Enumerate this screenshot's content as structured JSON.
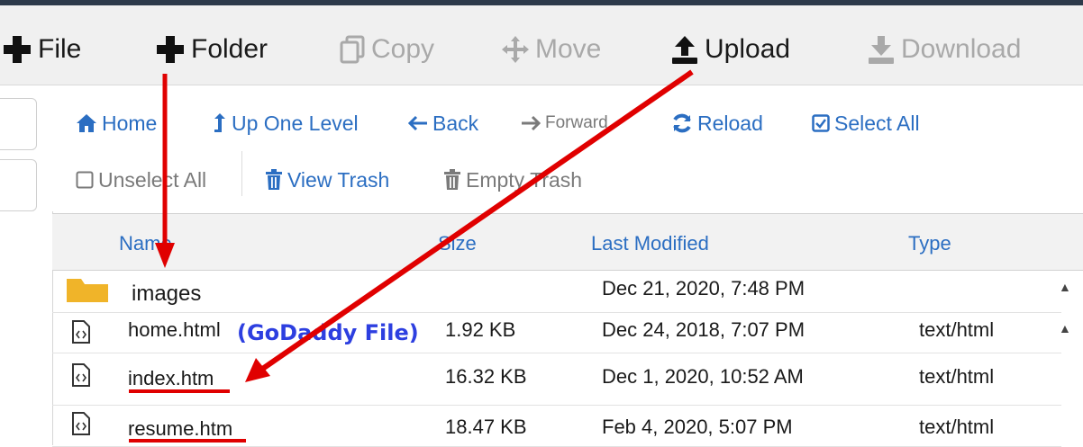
{
  "toolbar": {
    "file_label": "File",
    "folder_label": "Folder",
    "copy_label": "Copy",
    "move_label": "Move",
    "upload_label": "Upload",
    "download_label": "Download"
  },
  "actions": {
    "home": "Home",
    "up_one_level": "Up One Level",
    "back": "Back",
    "forward": "Forward",
    "reload": "Reload",
    "select_all": "Select All",
    "unselect_all": "Unselect All",
    "view_trash": "View Trash",
    "empty_trash": "Empty Trash"
  },
  "table": {
    "headers": {
      "name": "Name",
      "size": "Size",
      "last_modified": "Last Modified",
      "type": "Type"
    },
    "rows": [
      {
        "name": "images",
        "size": "",
        "modified": "Dec 21, 2020, 7:48 PM",
        "type": ""
      },
      {
        "name": "home.html",
        "size": "1.92 KB",
        "modified": "Dec 24, 2018, 7:07 PM",
        "type": "text/html"
      },
      {
        "name": "index.htm",
        "size": "16.32 KB",
        "modified": "Dec 1, 2020, 10:52 AM",
        "type": "text/html"
      },
      {
        "name": "resume.htm",
        "size": "18.47 KB",
        "modified": "Feb 4, 2020, 5:07 PM",
        "type": "text/html"
      }
    ]
  },
  "annotation": {
    "godaddy_label": "(GoDaddy File)"
  },
  "colors": {
    "link_blue": "#2b6ec2",
    "folder_yellow": "#f0b429",
    "annotation_red": "#e00000",
    "annotation_blue": "#2d3fe0"
  },
  "icons": {
    "file": "plus-icon",
    "folder": "plus-icon",
    "copy": "copy-icon",
    "move": "move-icon",
    "upload": "upload-icon",
    "download": "download-icon",
    "home": "home-icon",
    "up_one_level": "level-up-icon",
    "back": "arrow-left-icon",
    "forward": "arrow-right-icon",
    "reload": "refresh-icon",
    "select_all": "checkbox-checked-icon",
    "unselect_all": "checkbox-empty-icon",
    "view_trash": "trash-icon",
    "empty_trash": "trash-icon",
    "folder_row": "folder-icon",
    "file_row": "code-file-icon"
  }
}
